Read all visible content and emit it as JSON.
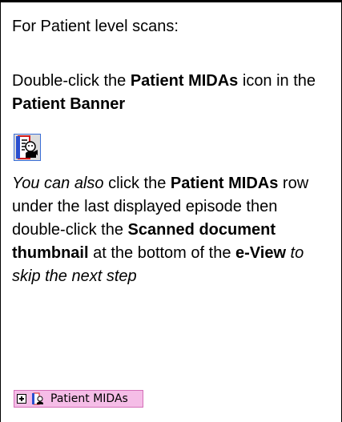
{
  "para1": "For Patient level scans:",
  "para2": {
    "t1": "Double-click the ",
    "b1": "Patient MIDAs",
    "t2": " icon in the ",
    "b2": "Patient Banner"
  },
  "para3": {
    "i1": "You can also",
    "t1": " click the ",
    "b1": "Patient MIDAs",
    "t2": " row under the last displayed episode then double-click the ",
    "b2": "Scanned document thumbnail",
    "t3": " at the bottom of the ",
    "b3": "e-View",
    "i2": " to skip the next step"
  },
  "midas_row": {
    "label": "Patient MIDAs"
  },
  "icons": {
    "banner_icon": "patient-midas-icon",
    "expand": "plus-box-icon"
  }
}
